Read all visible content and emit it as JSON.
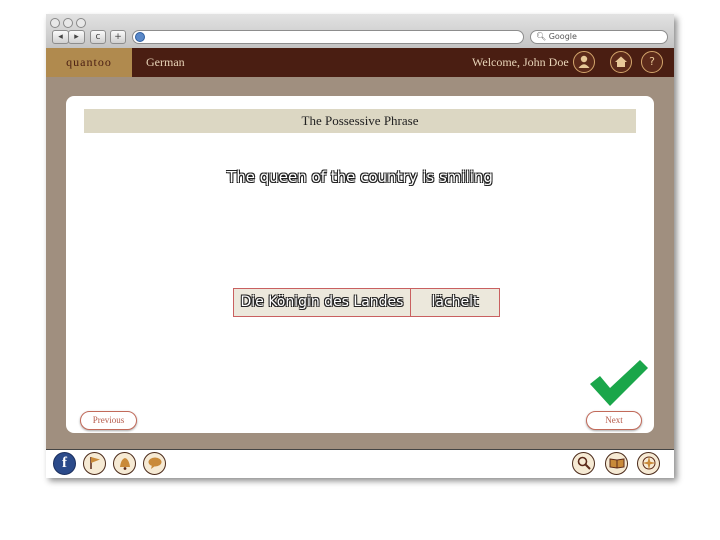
{
  "browser": {
    "back_label": "◂",
    "forward_label": "▸",
    "reload_label": "c",
    "add_label": "+",
    "search_placeholder": "Google"
  },
  "app": {
    "logo_text": "quantoo",
    "course": "German",
    "welcome": "Welcome, John Doe"
  },
  "header_icons": [
    "user-icon",
    "home-icon",
    "help-icon"
  ],
  "help_label": "?",
  "exercise": {
    "title": "The Possessive Phrase",
    "sentence": "The queen of the country is smiling",
    "answer_parts": [
      "Die Königin des Landes",
      "lächelt"
    ],
    "result": "correct"
  },
  "nav": {
    "previous": "Previous",
    "next": "Next"
  },
  "toolbar_left": [
    "facebook-icon",
    "flag-icon",
    "bell-icon",
    "speech-bubble-icon"
  ],
  "toolbar_right": [
    "magnifier-icon",
    "book-icon",
    "compass-icon"
  ],
  "facebook_label": "f",
  "colors": {
    "header": "#4a1e12",
    "logo_bg": "#b08a4e",
    "frame": "#a08f7f",
    "title_bar": "#dcd7c3",
    "check": "#1aa64a"
  }
}
